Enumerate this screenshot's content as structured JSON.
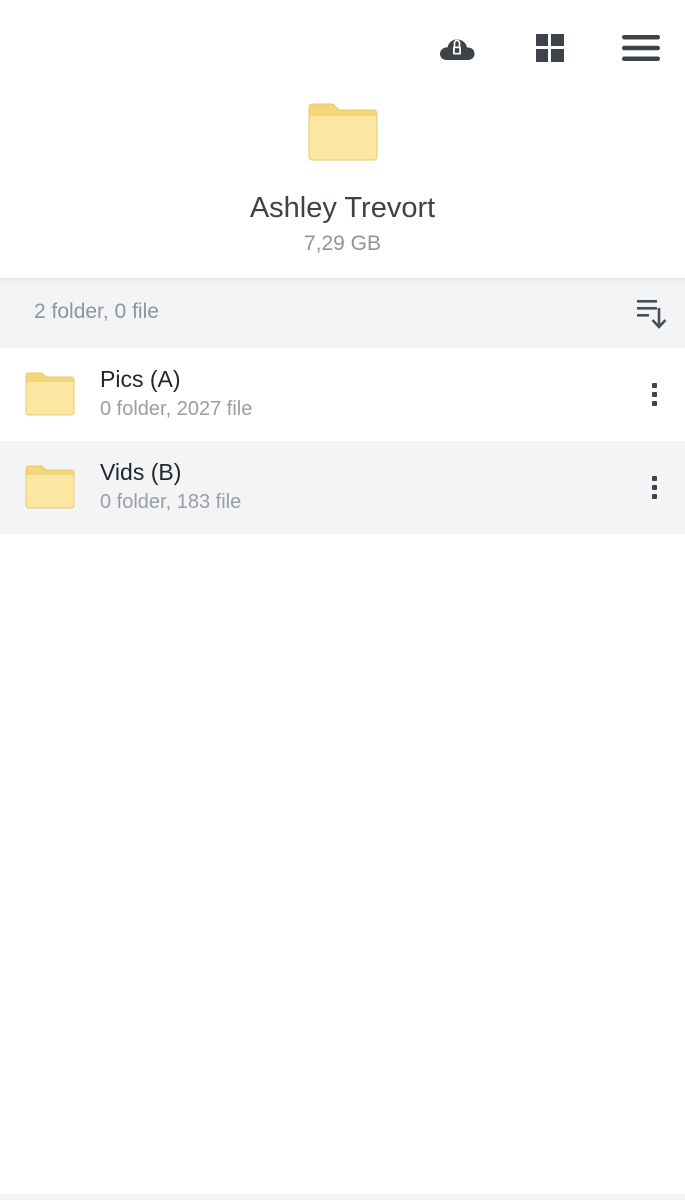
{
  "toolbar": {
    "icons": [
      "cloud-lock-icon",
      "grid-view-icon",
      "hamburger-menu-icon"
    ]
  },
  "header": {
    "title": "Ashley Trevort",
    "size": "7,29 GB"
  },
  "summary": {
    "text": "2 folder, 0 file"
  },
  "items": [
    {
      "name": "Pics (A)",
      "meta": "0 folder, 2027 file"
    },
    {
      "name": "Vids (B)",
      "meta": "0 folder, 183 file"
    }
  ],
  "colors": {
    "folder_fill": "#fbe7a1",
    "folder_tab": "#f5d77a",
    "folder_stroke": "#e9cb6d",
    "icon_dark": "#3e4349",
    "row_alt_bg": "#f3f4f6"
  }
}
